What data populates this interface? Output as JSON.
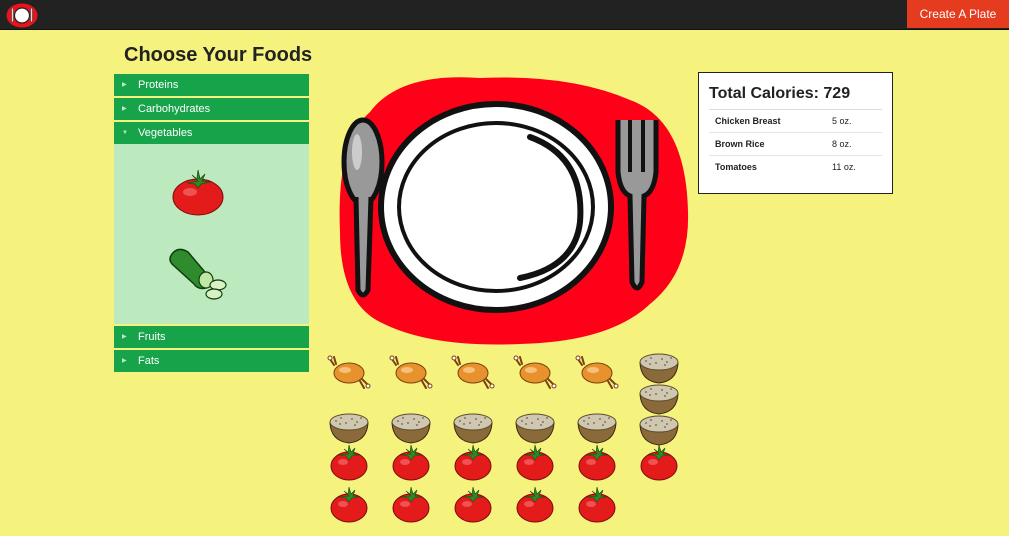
{
  "app": {
    "logo": "plate-logo-icon",
    "create_button": "Create A Plate"
  },
  "title": "Choose Your Foods",
  "accordion": {
    "sections": [
      {
        "label": "Proteins",
        "expanded": false
      },
      {
        "label": "Carbohydrates",
        "expanded": false
      },
      {
        "label": "Vegetables",
        "expanded": true,
        "items": [
          "tomato-icon",
          "cucumber-icon"
        ]
      },
      {
        "label": "Fruits",
        "expanded": false
      },
      {
        "label": "Fats",
        "expanded": false
      }
    ]
  },
  "plate": {
    "icon": "place-setting-icon"
  },
  "calories": {
    "title": "Total Calories: 729",
    "items": [
      {
        "name": "Chicken Breast",
        "amount": "5 oz."
      },
      {
        "name": "Brown Rice",
        "amount": "8 oz."
      },
      {
        "name": "Tomatoes",
        "amount": "11 oz."
      }
    ]
  },
  "plate_counts": {
    "chicken": 5,
    "rice": 8,
    "tomato": 11
  },
  "colors": {
    "topbar": "#222222",
    "accent": "#e53b1f",
    "accordion": "#17a34a",
    "panel": "#bde9bf",
    "background": "#f5f37e"
  }
}
